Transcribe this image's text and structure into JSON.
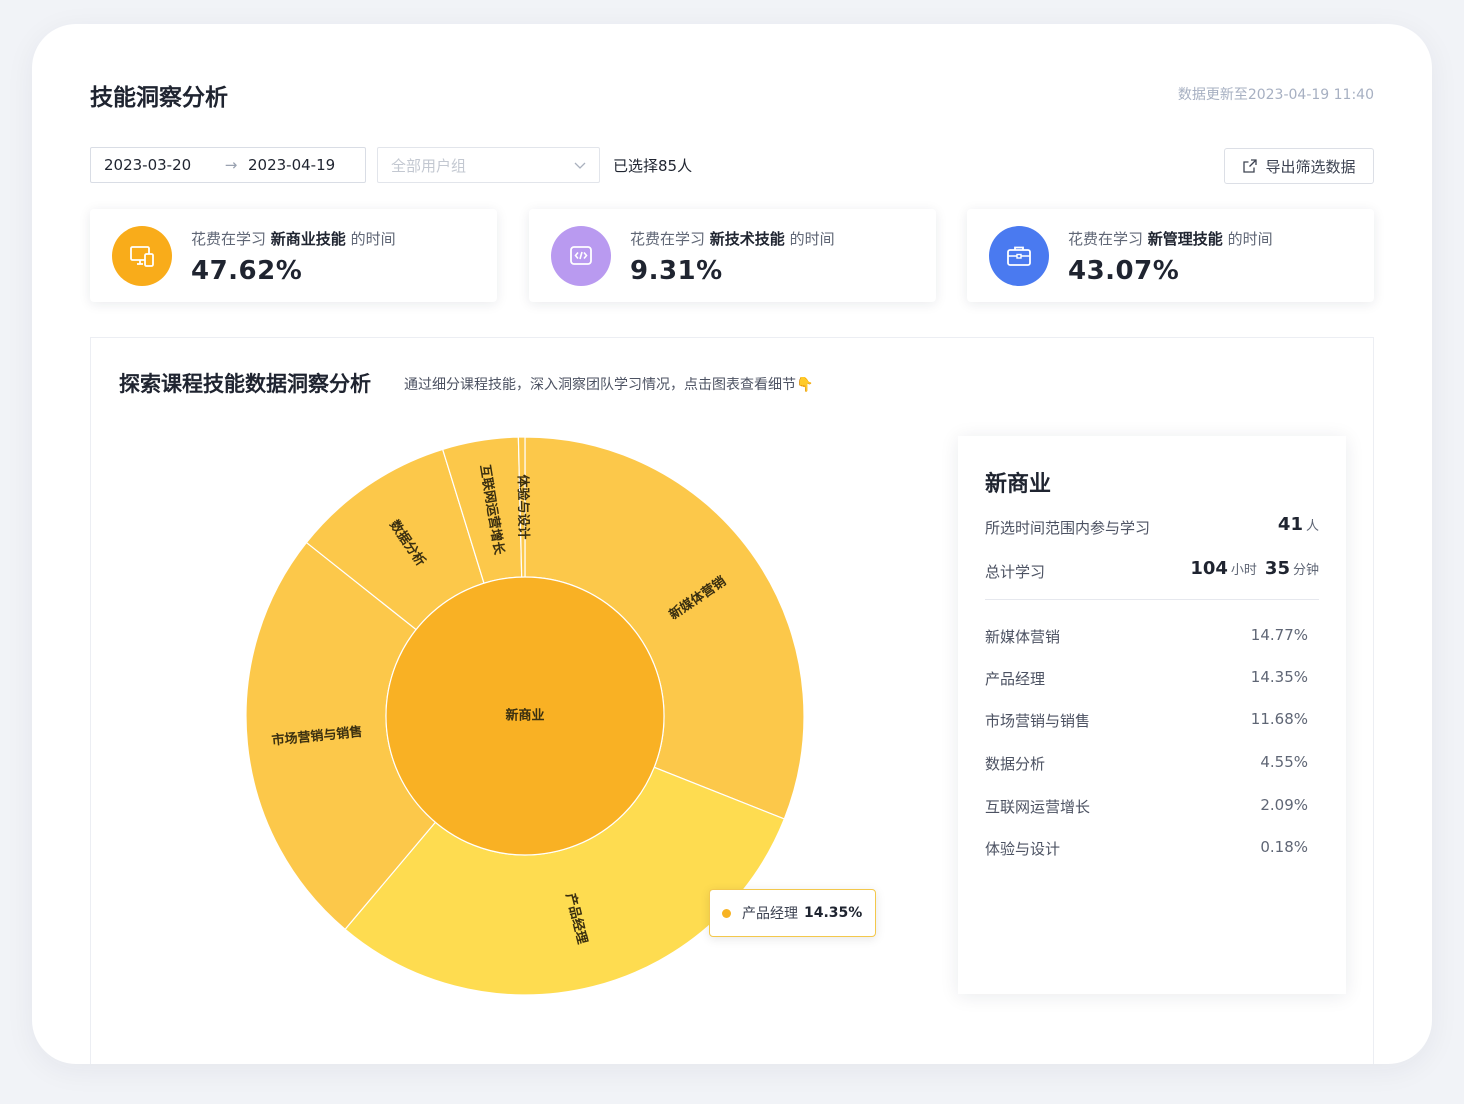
{
  "header": {
    "title": "技能洞察分析",
    "update_time": "数据更新至2023-04-19 11:40"
  },
  "filters": {
    "start_date": "2023-03-20",
    "end_date": "2023-04-19",
    "range_arrow": "→",
    "group_placeholder": "全部用户组",
    "selected_count": "已选择85人",
    "export_label": "导出筛选数据"
  },
  "stats": [
    {
      "icon": "devices-icon",
      "prefix": "花费在学习 ",
      "skill": "新商业技能",
      "suffix": " 的时间",
      "value": "47.62%",
      "color": "#f9ac1a"
    },
    {
      "icon": "code-icon",
      "prefix": "花费在学习 ",
      "skill": "新技术技能",
      "suffix": " 的时间",
      "value": "9.31%",
      "color": "#b99af0"
    },
    {
      "icon": "briefcase-icon",
      "prefix": "花费在学习 ",
      "skill": "新管理技能",
      "suffix": " 的时间",
      "value": "43.07%",
      "color": "#4a7af0"
    }
  ],
  "explore": {
    "title": "探索课程技能数据洞察分析",
    "subtitle": "通过细分课程技能，深入洞察团队学习情况，点击图表查看细节👇"
  },
  "chart_data": {
    "type": "sunburst",
    "center": {
      "label": "新商业",
      "color": "#f9b124"
    },
    "segments": [
      {
        "name": "新媒体营销",
        "value": 14.77,
        "color": "#fcc84a"
      },
      {
        "name": "产品经理",
        "value": 14.35,
        "color": "#fedc50"
      },
      {
        "name": "市场营销与销售",
        "value": 11.68,
        "color": "#fcc84a"
      },
      {
        "name": "数据分析",
        "value": 4.55,
        "color": "#fcc84a"
      },
      {
        "name": "互联网运营增长",
        "value": 2.09,
        "color": "#fcc84a"
      },
      {
        "name": "体验与设计",
        "value": 0.18,
        "color": "#fcc84a"
      }
    ]
  },
  "tooltip": {
    "name": "产品经理",
    "value": "14.35%"
  },
  "detail": {
    "title": "新商业",
    "participants_label": "所选时间范围内参与学习",
    "participants_value": "41",
    "participants_unit": "人",
    "total_label": "总计学习",
    "hours_value": "104",
    "hours_unit": "小时",
    "minutes_value": "35",
    "minutes_unit": "分钟",
    "items": [
      {
        "name": "新媒体营销",
        "pct": "14.77%"
      },
      {
        "name": "产品经理",
        "pct": "14.35%"
      },
      {
        "name": "市场营销与销售",
        "pct": "11.68%"
      },
      {
        "name": "数据分析",
        "pct": "4.55%"
      },
      {
        "name": "互联网运营增长",
        "pct": "2.09%"
      },
      {
        "name": "体验与设计",
        "pct": "0.18%"
      }
    ]
  }
}
